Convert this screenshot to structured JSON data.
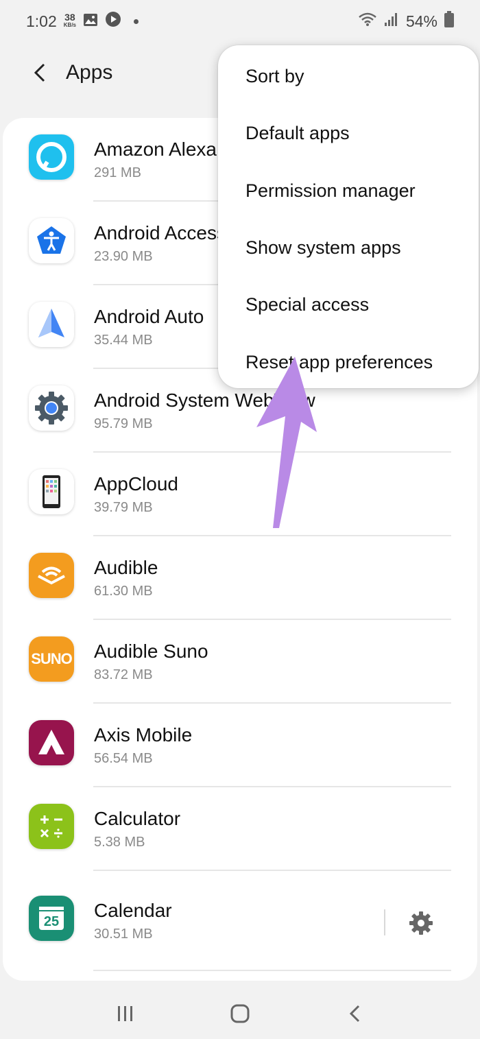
{
  "status_bar": {
    "time": "1:02",
    "speed_value": "38",
    "speed_unit": "KB/s",
    "battery": "54%",
    "icons": [
      "gallery-icon",
      "play-icon",
      "dot-icon",
      "wifi-icon",
      "signal-icon",
      "battery-icon"
    ]
  },
  "header": {
    "title": "Apps",
    "back_icon": "back-arrow-icon"
  },
  "apps": [
    {
      "name": "Amazon Alexa",
      "size": "291 MB",
      "icon": "alexa-icon",
      "color": "#1fc0ee"
    },
    {
      "name": "Android Accessibility Suite",
      "size": "23.90 MB",
      "icon": "accessibility-icon",
      "color": "#1a73e8"
    },
    {
      "name": "Android Auto",
      "size": "35.44 MB",
      "icon": "android-auto-icon",
      "color": "#4285f4"
    },
    {
      "name": "Android System WebView",
      "size": "95.79 MB",
      "icon": "webview-gear-icon",
      "color": "#4b5a66"
    },
    {
      "name": "AppCloud",
      "size": "39.79 MB",
      "icon": "appcloud-icon",
      "color": "#222222"
    },
    {
      "name": "Audible",
      "size": "61.30 MB",
      "icon": "audible-icon",
      "color": "#f39c1f"
    },
    {
      "name": "Audible Suno",
      "size": "83.72 MB",
      "icon": "suno-icon",
      "color": "#f39c1f",
      "label": "SUNO"
    },
    {
      "name": "Axis Mobile",
      "size": "56.54 MB",
      "icon": "axis-icon",
      "color": "#97144d"
    },
    {
      "name": "Calculator",
      "size": "5.38 MB",
      "icon": "calculator-icon",
      "color": "#8cc21a"
    },
    {
      "name": "Calendar",
      "size": "30.51 MB",
      "icon": "calendar-icon",
      "color": "#1a8f74",
      "label": "25"
    }
  ],
  "menu": {
    "items": [
      "Sort by",
      "Default apps",
      "Permission manager",
      "Show system apps",
      "Special access",
      "Reset app preferences"
    ]
  },
  "annotation": {
    "arrow_color": "#b98ae6"
  },
  "nav_bar": {
    "icons": [
      "recents-icon",
      "home-icon",
      "back-icon"
    ]
  }
}
